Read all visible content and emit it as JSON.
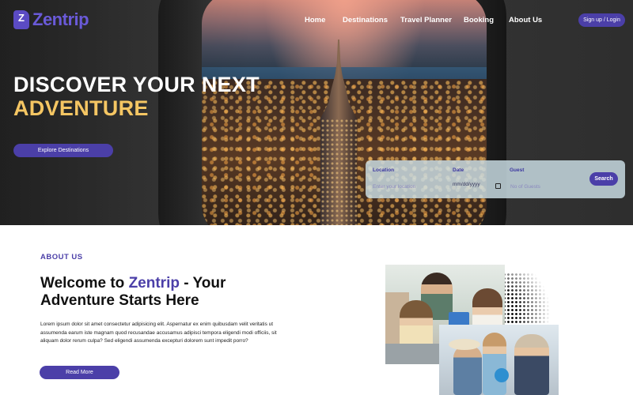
{
  "header": {
    "logo_text": "Zentrip",
    "logo_mark": "Z",
    "nav": [
      "Home",
      "Destinations",
      "Travel Planner",
      "Booking",
      "About Us"
    ],
    "signup_label": "Sign up / Login"
  },
  "hero": {
    "headline_line1": "DISCOVER YOUR NEXT",
    "headline_line2": "ADVENTURE",
    "explore_label": "Explore Destinations"
  },
  "search": {
    "location_label": "Location",
    "location_placeholder": "Enter your location",
    "date_label": "Date",
    "date_value": "mm/dd/yyyy",
    "guest_label": "Guest",
    "guest_placeholder": "No of Guests",
    "search_label": "Search",
    "calendar_icon": "calendar-icon"
  },
  "about": {
    "tag": "ABOUT US",
    "title_prefix": "Welcome to ",
    "title_brand": "Zentrip",
    "title_suffix": " - Your Adventure Starts Here",
    "body": "Lorem ipsum dolor sit amet consectetur adipisicing elit. Aspernatur ex enim quibusdam velit veritatis ut assumenda earum iste magnam quod recusandae accusamus adipisci tempora eligendi modi officiis, sit aliquam dolor rerum culpa? Sed eligendi assumenda excepturi dolorem sunt impedit porro?",
    "read_more_label": "Read More"
  },
  "colors": {
    "accent": "#4b3fa8",
    "highlight": "#f5c663",
    "logo": "#6a5ad8"
  }
}
